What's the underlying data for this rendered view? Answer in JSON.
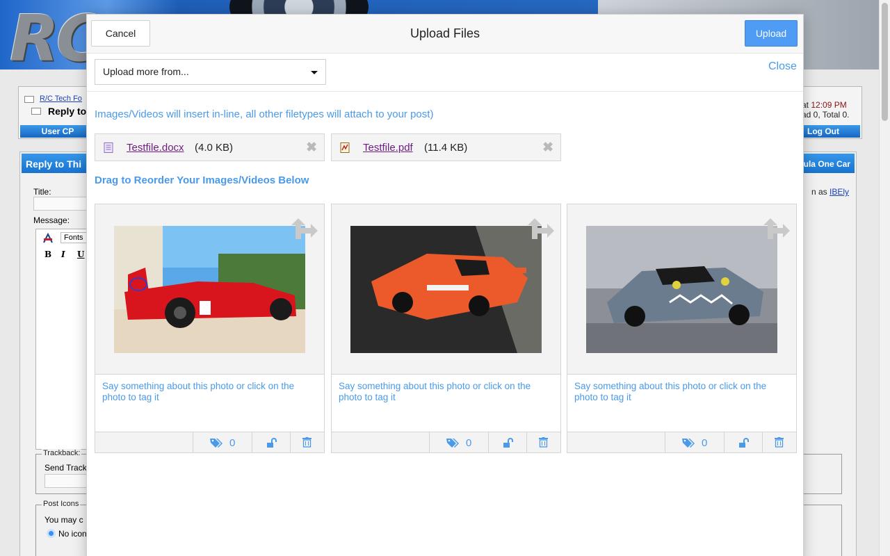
{
  "background": {
    "logo_text": "RC",
    "breadcrumb_forum": "R/C Tech Fo",
    "breadcrumb_page": "Reply to",
    "time_prefix": "at",
    "time_value": "12:09 PM",
    "online_text": "ad 0, Total 0.",
    "nav_user_cp": "User CP",
    "nav_logout": "Log Out",
    "panel_title": "Reply to Thi",
    "panel_title_right": "ula One Car",
    "logged_in_prefix": "n as",
    "logged_in_user": "IBEly",
    "title_label": "Title:",
    "message_label": "Message:",
    "fonts_label": "Fonts",
    "format_bold": "B",
    "format_italic": "I",
    "format_underline": "U",
    "trackback_legend": "Trackback:",
    "trackback_send": "Send Track",
    "post_icons_legend": "Post Icons",
    "post_icons_text": "You may c",
    "no_icon_label": "No icon"
  },
  "modal": {
    "title": "Upload Files",
    "cancel_label": "Cancel",
    "upload_label": "Upload",
    "close_label": "Close",
    "source_select_value": "Upload more from...",
    "info_note": "Images/Videos will insert in-line, all other filetypes will attach to your post)",
    "attachments": [
      {
        "name": "Testfile.docx",
        "size": "(4.0 KB)",
        "icon": "word-document-icon"
      },
      {
        "name": "Testfile.pdf",
        "size": "(11.4 KB)",
        "icon": "pdf-document-icon"
      }
    ],
    "reorder_heading": "Drag to Reorder Your Images/Videos Below",
    "photos": [
      {
        "subject": "red race car photo",
        "caption_placeholder": "Say something about this photo or click on the photo to tag it",
        "tag_count": "0"
      },
      {
        "subject": "orange race car photo",
        "caption_placeholder": "Say something about this photo or click on the photo to tag it",
        "tag_count": "0"
      },
      {
        "subject": "grey shark-livery race car photo",
        "caption_placeholder": "Say something about this photo or click on the photo to tag it",
        "tag_count": "0"
      }
    ]
  },
  "colors": {
    "accent": "#4a9ae8",
    "upload_button": "#4e9cf4",
    "file_link": "#6d1e80",
    "forum_blue": "#1973cf"
  }
}
